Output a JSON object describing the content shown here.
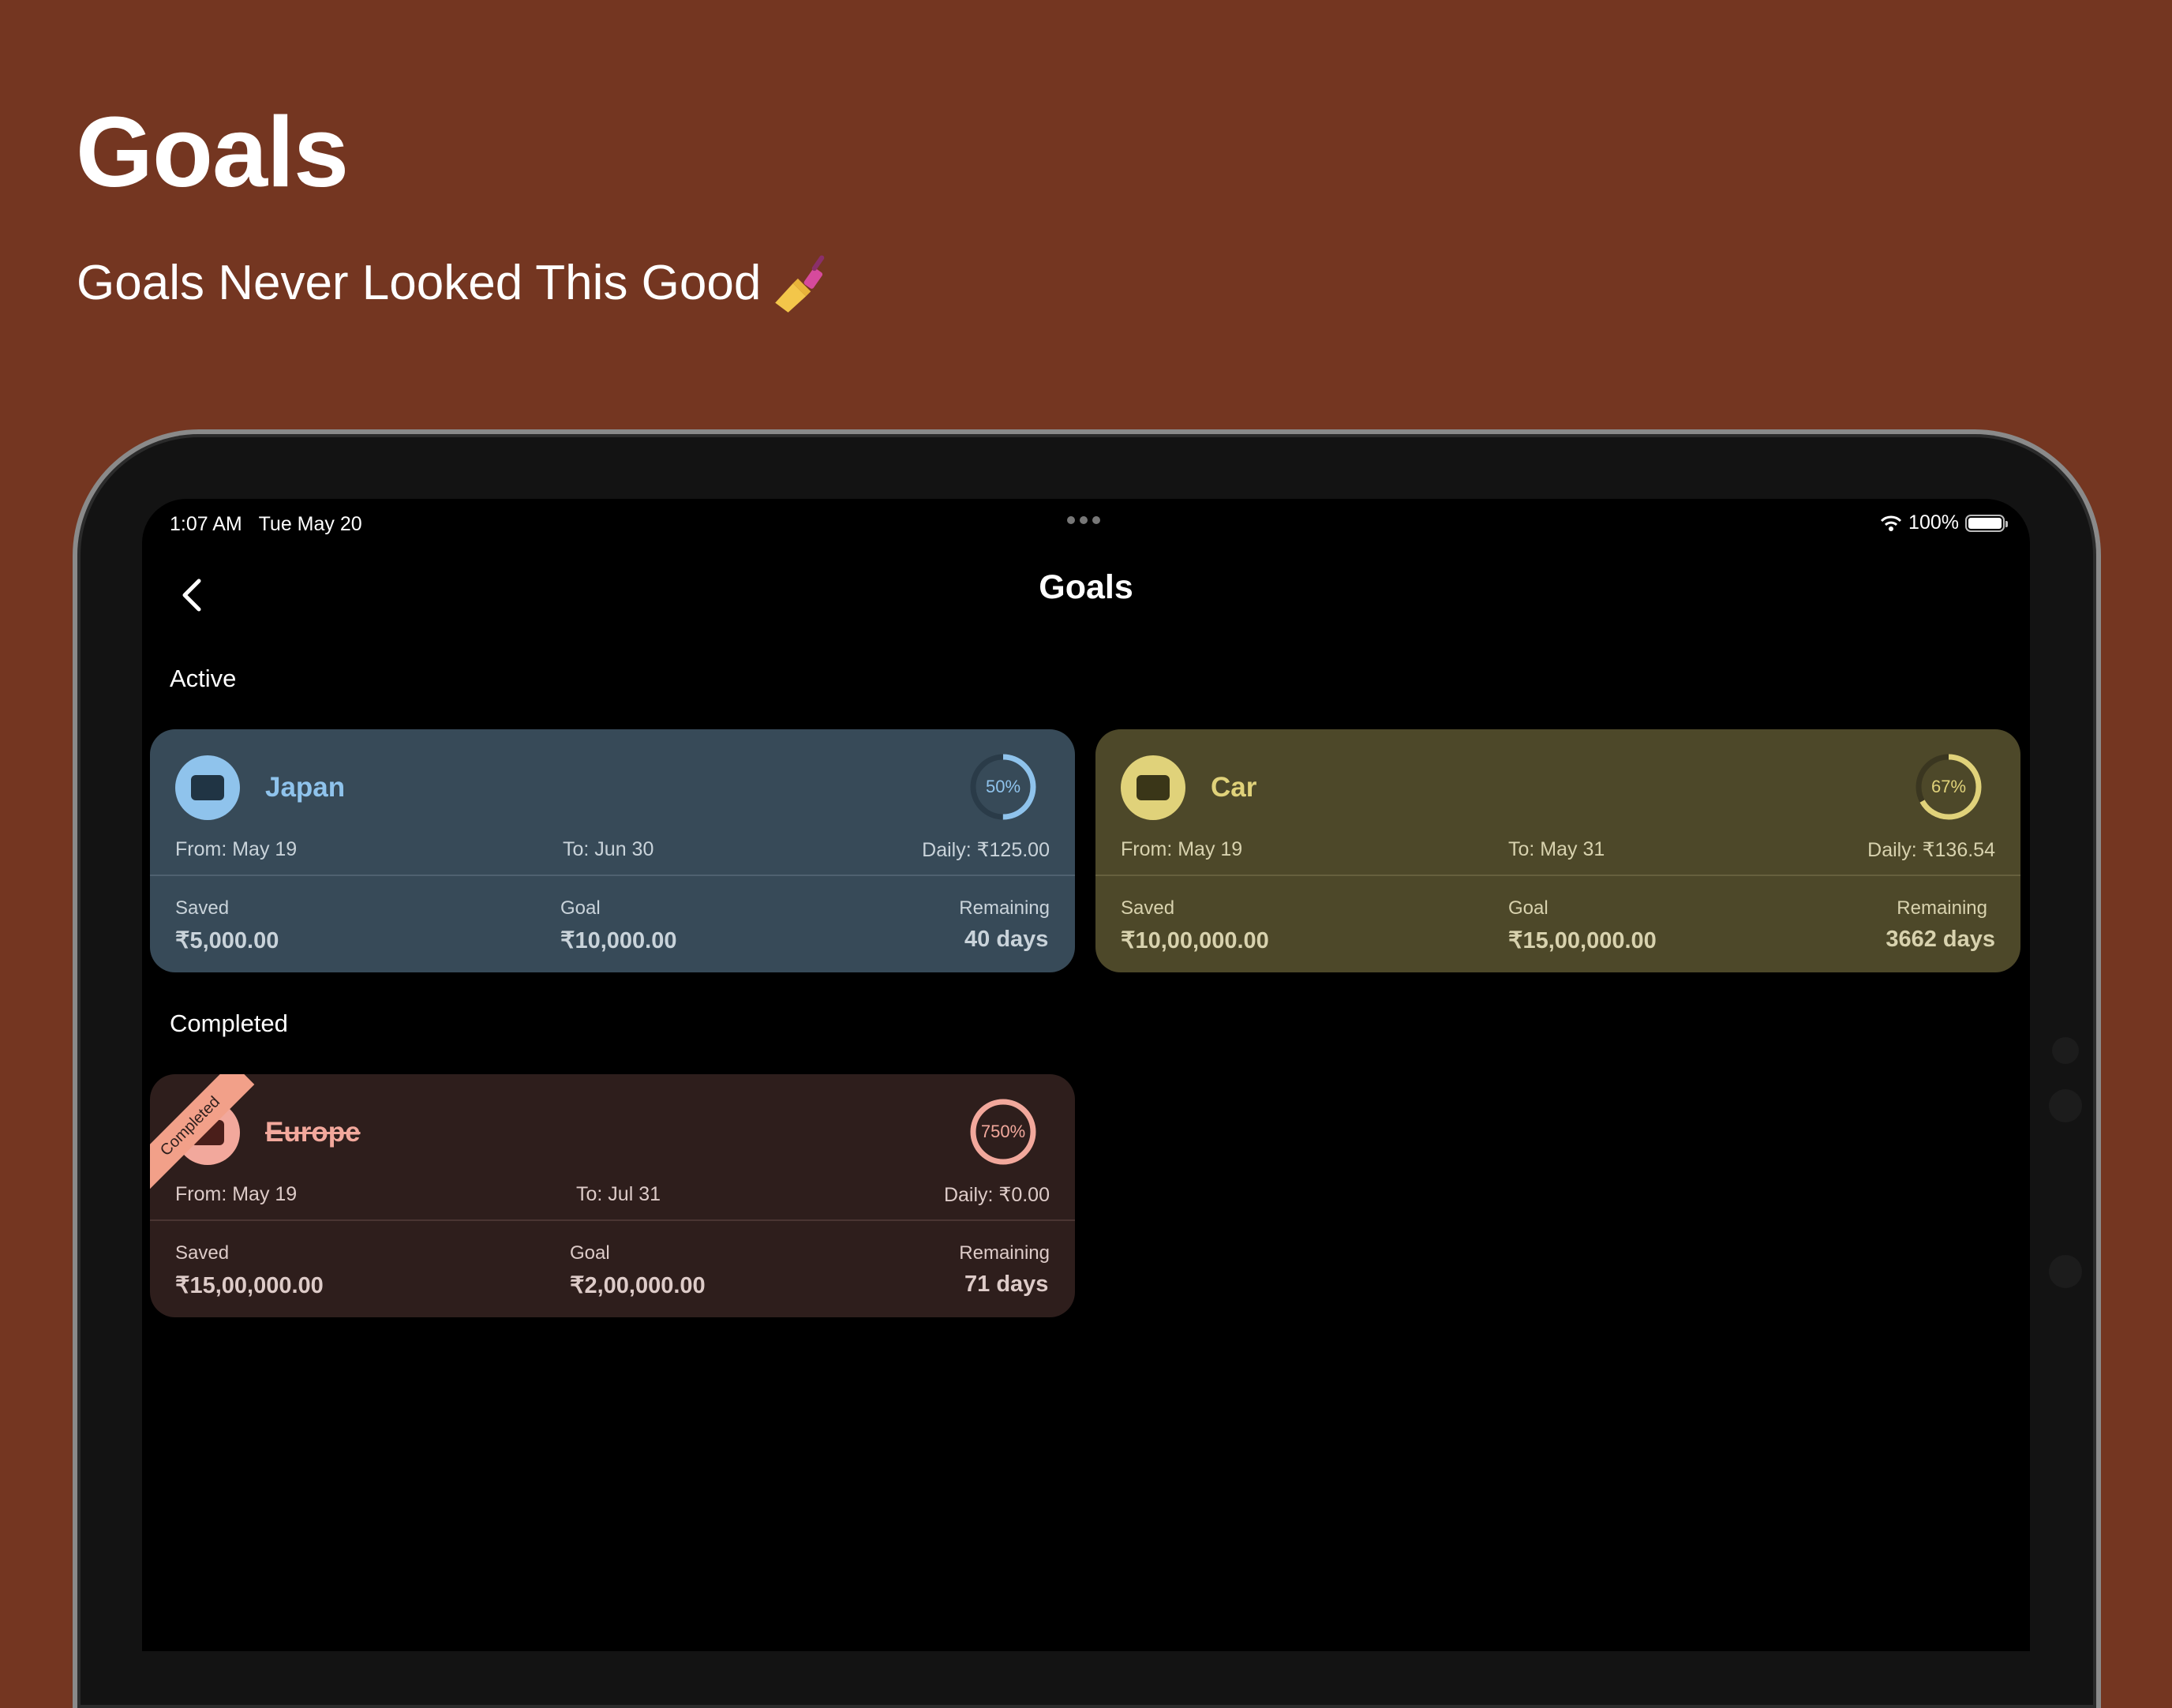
{
  "promo": {
    "title": "Goals",
    "subtitle": "Goals Never Looked This Good"
  },
  "status_bar": {
    "time": "1:07 AM",
    "date": "Tue May 20",
    "battery": "100%"
  },
  "nav": {
    "title": "Goals"
  },
  "sections": {
    "active": "Active",
    "completed": "Completed"
  },
  "goals": {
    "japan": {
      "name": "Japan",
      "progress": 50,
      "progress_label": "50%",
      "from": "From: May 19",
      "to": "To: Jun 30",
      "daily": "Daily: ₹125.00",
      "saved_label": "Saved",
      "saved": "₹5,000.00",
      "goal_label": "Goal",
      "goal": "₹10,000.00",
      "remaining_label": "Remaining",
      "remaining": "40 days",
      "color": "#8fc3ec"
    },
    "car": {
      "name": "Car",
      "progress": 67,
      "progress_label": "67%",
      "from": "From: May 19",
      "to": "To: May 31",
      "daily": "Daily: ₹136.54",
      "saved_label": "Saved",
      "saved": "₹10,00,000.00",
      "goal_label": "Goal",
      "goal": "₹15,00,000.00",
      "remaining_label": "Remaining",
      "remaining": "3662 days",
      "color": "#e0d27a"
    },
    "europe": {
      "name": "Europe",
      "badge": "Completed",
      "progress": 750,
      "progress_label": "750%",
      "from": "From: May 19",
      "to": "To: Jul 31",
      "daily": "Daily: ₹0.00",
      "saved_label": "Saved",
      "saved": "₹15,00,000.00",
      "goal_label": "Goal",
      "goal": "₹2,00,000.00",
      "remaining_label": "Remaining",
      "remaining": "71 days",
      "color": "#f2a89c"
    }
  },
  "icons": {
    "back": "chevron-left-icon",
    "card": "credit-card-icon",
    "wifi": "wifi-icon",
    "battery": "battery-icon",
    "emoji": "nail-polish-emoji"
  }
}
